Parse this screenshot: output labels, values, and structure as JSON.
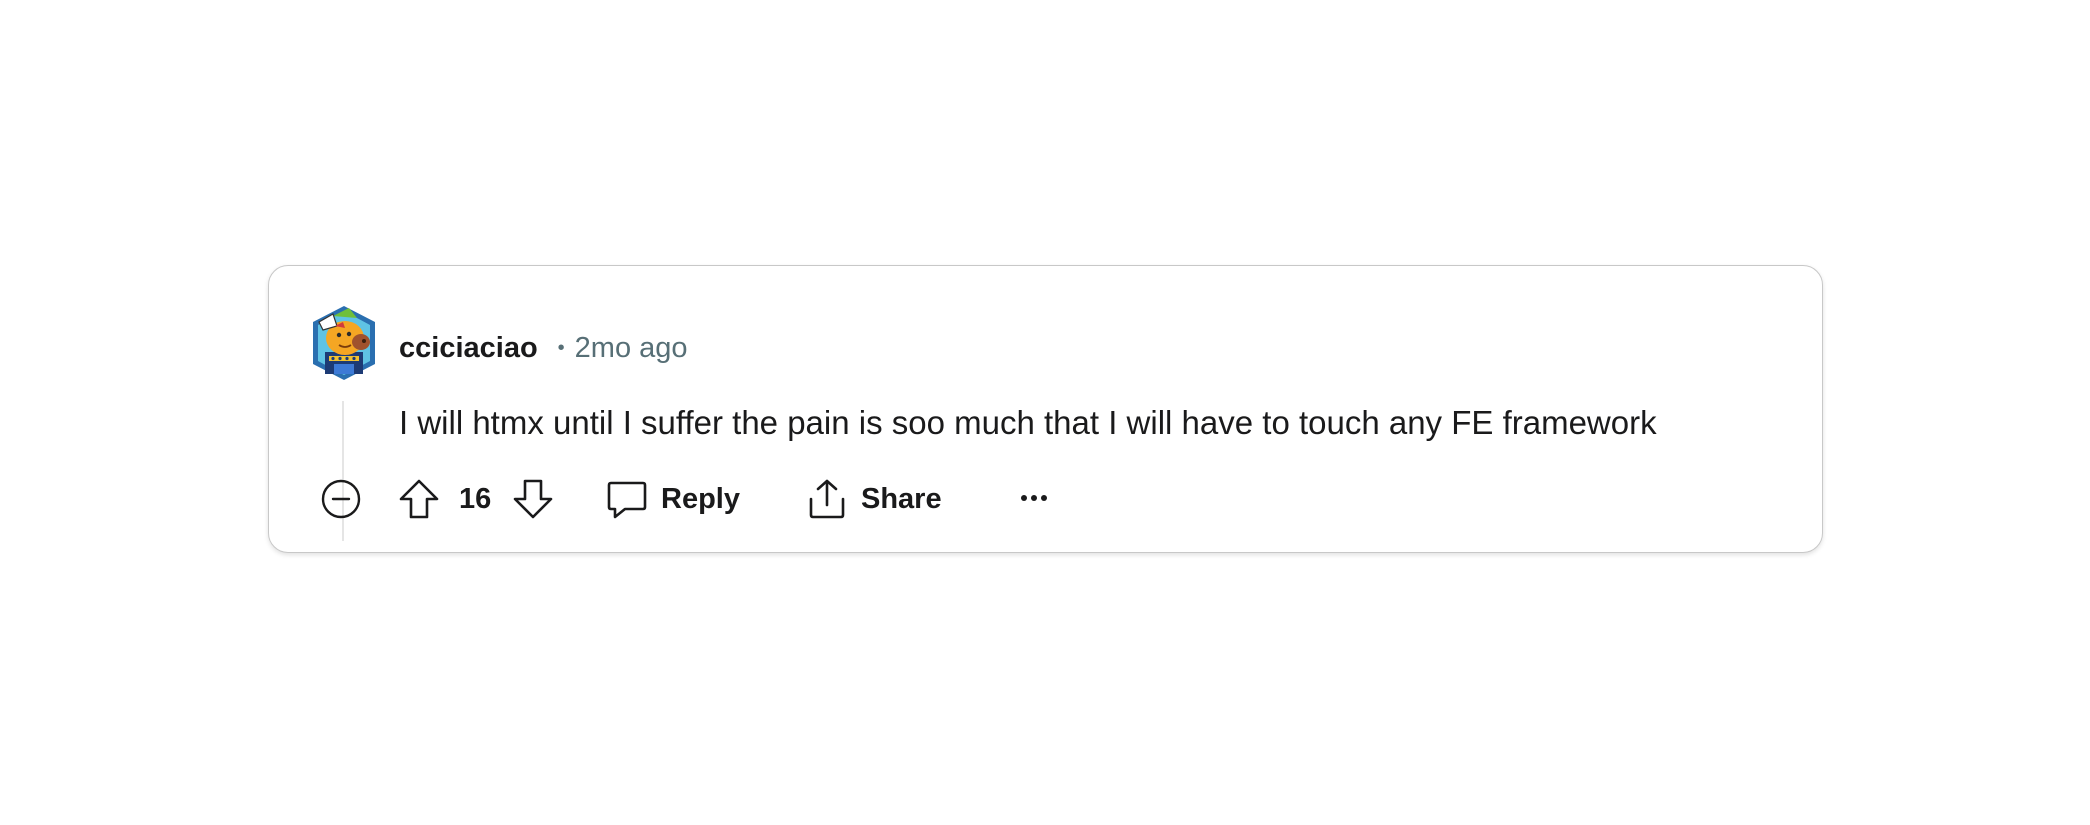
{
  "comment": {
    "author": "cciciaciao",
    "separator": "•",
    "timestamp": "2mo ago",
    "body": "I will htmx until I suffer the pain is soo much that I will have to touch any FE framework",
    "score": "16"
  },
  "actions": {
    "reply_label": "Reply",
    "share_label": "Share"
  },
  "icons": {
    "avatar": "user-avatar",
    "collapse": "collapse-minus-icon",
    "upvote": "upvote-arrow-icon",
    "downvote": "downvote-arrow-icon",
    "reply": "speech-bubble-icon",
    "share": "share-upload-icon",
    "more": "more-dots-icon"
  },
  "colors": {
    "text": "#1a1a1b",
    "meta": "#576f76",
    "border": "#c8c8c8",
    "thread_line": "#e5e5e5"
  }
}
